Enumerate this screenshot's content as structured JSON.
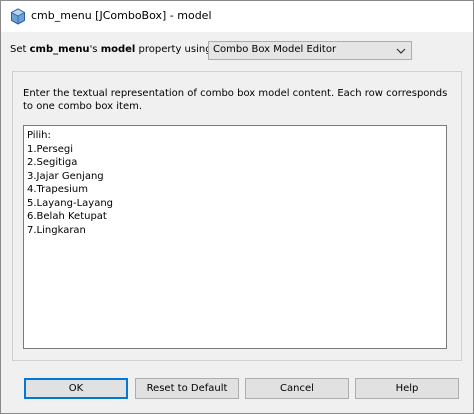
{
  "window": {
    "title": "cmb_menu [JComboBox] - model"
  },
  "property_row": {
    "prefix": "Set ",
    "component": "cmb_menu",
    "middle": "'s ",
    "property": "model",
    "suffix": " property using:",
    "editor_selected": "Combo Box Model Editor"
  },
  "editor": {
    "instructions": "Enter the textual representation of combo box model content. Each row corresponds to one combo box item.",
    "items": [
      "Pilih:",
      "1.Persegi",
      "2.Segitiga",
      "3.Jajar Genjang",
      "4.Trapesium",
      "5.Layang-Layang",
      "6.Belah Ketupat",
      "7.Lingkaran"
    ]
  },
  "buttons": {
    "ok": "OK",
    "reset": "Reset to Default",
    "cancel": "Cancel",
    "help": "Help"
  },
  "icons": {
    "window": "netbeans-bean-icon",
    "dropdown": "chevron-down-icon"
  }
}
